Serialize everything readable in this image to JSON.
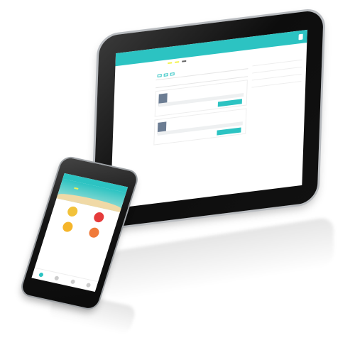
{
  "tablet": {
    "header_title": "",
    "header_button": "",
    "top_label": "",
    "top_tags": [
      "",
      "",
      ""
    ],
    "footer_link": "",
    "accent": "#2cc3c2"
  },
  "phone": {
    "status_text": "",
    "banner_title": "",
    "menu": [
      {
        "label": "",
        "color": "#f2c23a",
        "icon": "food-icon"
      },
      {
        "label": "",
        "color": "#e53b3b",
        "icon": "order-icon"
      },
      {
        "label": "",
        "color": "#f5b52a",
        "icon": "reserve-icon"
      },
      {
        "label": "",
        "color": "#f07a3a",
        "icon": "coupon-icon"
      }
    ],
    "accent": "#2cc3c2"
  }
}
